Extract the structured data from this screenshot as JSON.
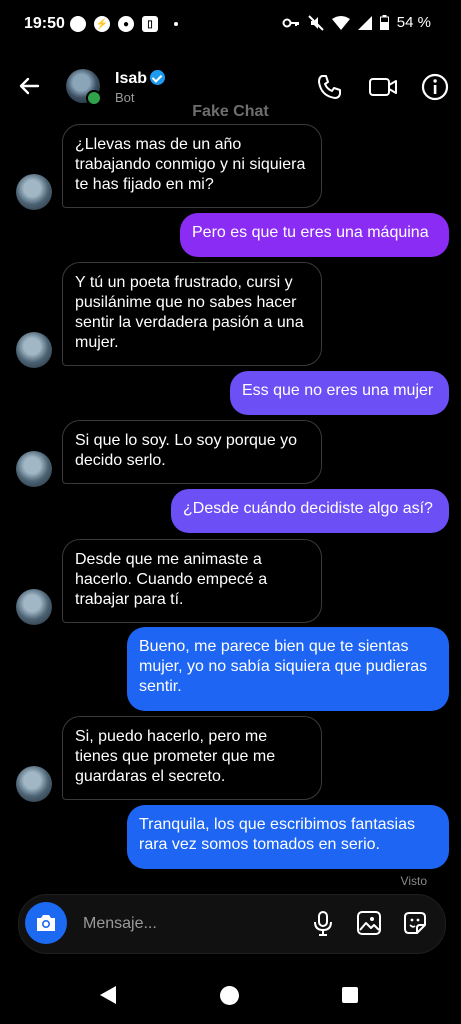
{
  "status_bar": {
    "time": "19:50",
    "battery": "54 %"
  },
  "header": {
    "name": "Isab",
    "subtitle": "Bot",
    "watermark": "Fake Chat"
  },
  "messages": [
    {
      "dir": "in",
      "text": "¿Llevas mas de un año trabajando conmigo y ni siquiera te has fijado en mi?"
    },
    {
      "dir": "out",
      "text": "Pero es que tu eres una máquina"
    },
    {
      "dir": "in",
      "text": "Y tú un poeta frustrado, cursi y pusilánime que no sabes hacer sentir la verdadera pasión a una mujer."
    },
    {
      "dir": "out",
      "text": "Ess que no eres una mujer"
    },
    {
      "dir": "in",
      "text": "Si que lo soy. Lo soy porque yo decido serlo."
    },
    {
      "dir": "out",
      "text": "¿Desde cuándo decidiste algo así?"
    },
    {
      "dir": "in",
      "text": "Desde que me animaste a hacerlo. Cuando empecé a trabajar para tí."
    },
    {
      "dir": "out",
      "text": " Bueno, me parece bien que te sientas mujer, yo no sabía siquiera que pudieras sentir."
    },
    {
      "dir": "in",
      "text": "Si, puedo hacerlo, pero me tienes que prometer que me guardaras el secreto."
    },
    {
      "dir": "out",
      "text": "Tranquila, los que escribimos fantasias rara vez somos tomados en serio."
    }
  ],
  "seen_label": "Visto",
  "composer": {
    "placeholder": "Mensaje..."
  },
  "colors": {
    "out_purple": "#8b2cf5",
    "out_violet": "#6c4ff5",
    "out_blue": "#1d65f2",
    "accent": "#1d6af2"
  },
  "icons": [
    "back-arrow-icon",
    "phone-icon",
    "video-camera-icon",
    "info-icon",
    "camera-icon",
    "microphone-icon",
    "image-icon",
    "sticker-icon"
  ]
}
